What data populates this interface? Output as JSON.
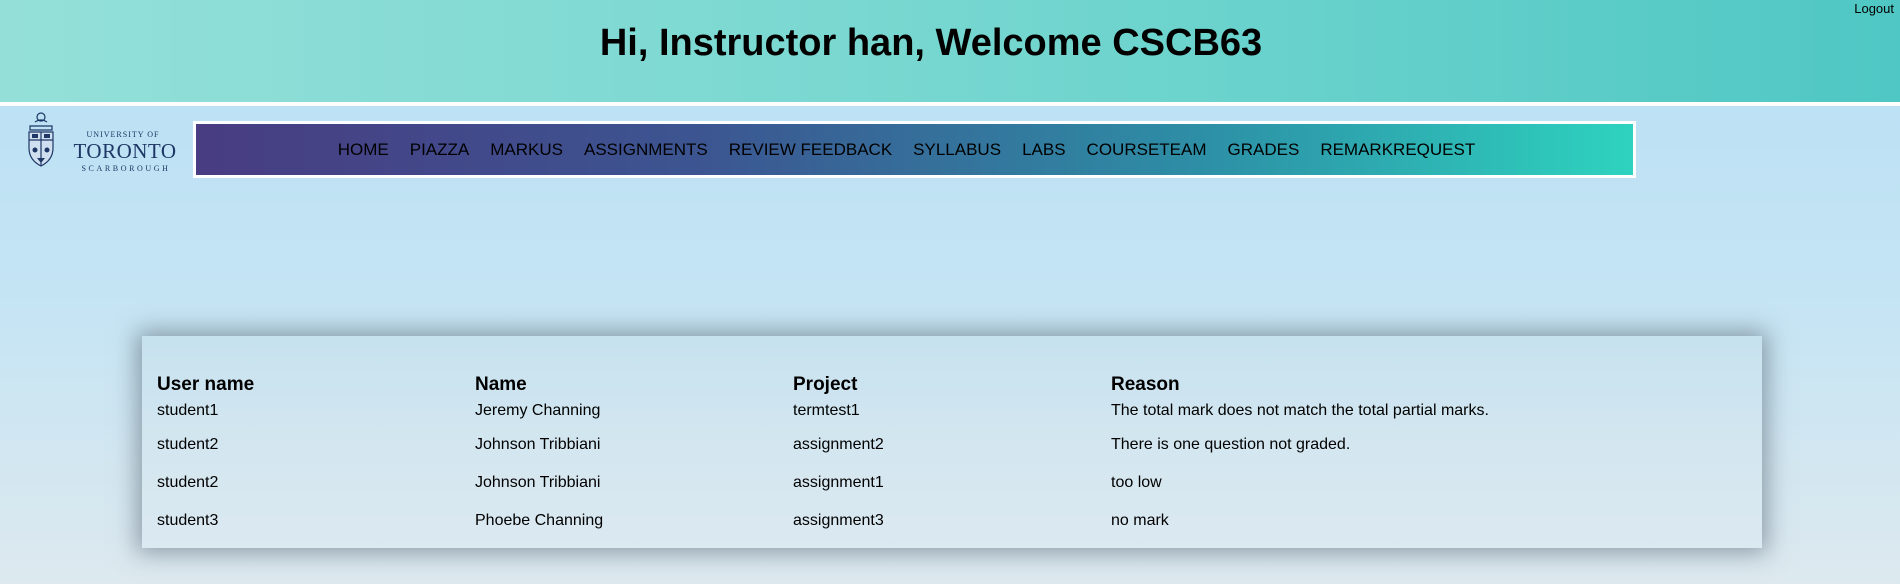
{
  "header": {
    "title": "Hi, Instructor han, Welcome CSCB63",
    "logout_label": "Logout"
  },
  "logo": {
    "line_top": "UNIVERSITY OF",
    "line_main": "TORONTO",
    "line_bottom": "SCARBOROUGH"
  },
  "nav": {
    "items": [
      {
        "label": "HOME"
      },
      {
        "label": "PIAZZA"
      },
      {
        "label": "MARKUS"
      },
      {
        "label": "ASSIGNMENTS"
      },
      {
        "label": "REVIEW FEEDBACK"
      },
      {
        "label": "SYLLABUS"
      },
      {
        "label": "LABS"
      },
      {
        "label": "COURSETEAM"
      },
      {
        "label": "GRADES"
      },
      {
        "label": "REMARKREQUEST"
      }
    ]
  },
  "table": {
    "headers": [
      "User name",
      "Name",
      "Project",
      "Reason"
    ],
    "rows": [
      [
        "student1",
        "Jeremy Channing",
        "termtest1",
        "The total mark does not match the total partial marks."
      ],
      [
        "student2",
        "Johnson Tribbiani",
        "assignment2",
        "There is one question not graded."
      ],
      [
        "student2",
        "Johnson Tribbiani",
        "assignment1",
        "too low"
      ],
      [
        "student3",
        "Phoebe Channing",
        "assignment3",
        "no mark"
      ]
    ]
  },
  "colors": {
    "header_start": "#94e0d9",
    "header_end": "#4fc7c4",
    "nav_start": "#483c82",
    "nav_end": "#2ed3bf",
    "brand_navy": "#1e3765"
  },
  "icons": {
    "logo": "university-crest-icon"
  }
}
